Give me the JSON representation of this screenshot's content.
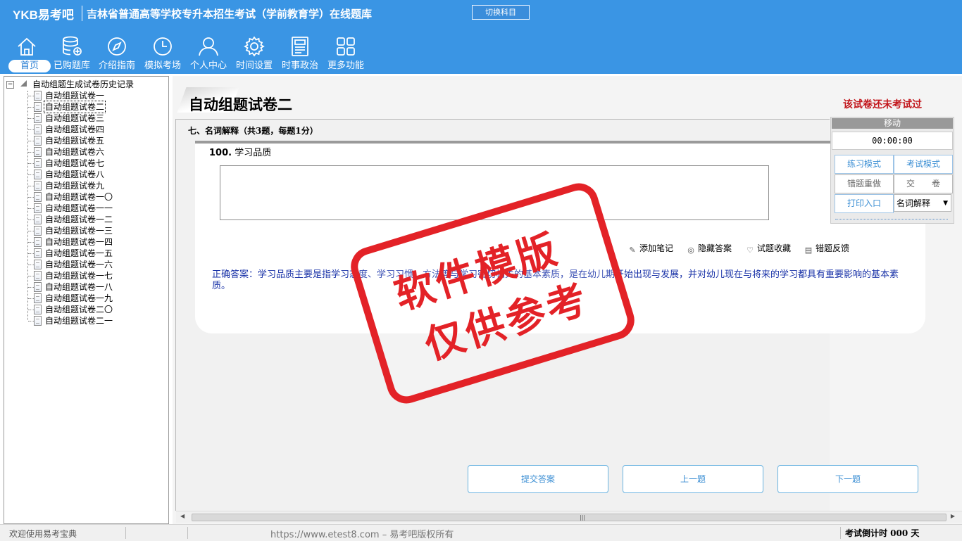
{
  "header": {
    "brand": "YKB易考吧",
    "title": "吉林省普通高等学校专升本招生考试（学前教育学）在线题库",
    "switch_label": "切换科目"
  },
  "nav": [
    {
      "label": "首页",
      "icon": "home-icon"
    },
    {
      "label": "已购题库",
      "icon": "database-icon"
    },
    {
      "label": "介绍指南",
      "icon": "compass-icon"
    },
    {
      "label": "模拟考场",
      "icon": "clock-icon"
    },
    {
      "label": "个人中心",
      "icon": "user-icon"
    },
    {
      "label": "时间设置",
      "icon": "gear-icon"
    },
    {
      "label": "时事政治",
      "icon": "newspaper-icon"
    },
    {
      "label": "更多功能",
      "icon": "grid-icon"
    }
  ],
  "tree": {
    "root": "自动组题生成试卷历史记录",
    "items": [
      "自动组题试卷一",
      "自动组题试卷二",
      "自动组题试卷三",
      "自动组题试卷四",
      "自动组题试卷五",
      "自动组题试卷六",
      "自动组题试卷七",
      "自动组题试卷八",
      "自动组题试卷九",
      "自动组题试卷一〇",
      "自动组题试卷一一",
      "自动组题试卷一二",
      "自动组题试卷一三",
      "自动组题试卷一四",
      "自动组题试卷一五",
      "自动组题试卷一六",
      "自动组题试卷一七",
      "自动组题试卷一八",
      "自动组题试卷一九",
      "自动组题试卷二〇",
      "自动组题试卷二一"
    ],
    "selected_index": 1
  },
  "main": {
    "paper_title": "自动组题试卷二",
    "status_note": "该试卷还未考试过",
    "section_title": "七、名词解释（共3题，每题1分）",
    "question_number": "100.",
    "question_text": "学习品质",
    "tools": {
      "note": "添加笔记",
      "hide": "隐藏答案",
      "favorite": "试题收藏",
      "feedback": "错题反馈"
    },
    "correct_answer": "正确答案：学习品质主要是指学习态度、学习习惯、方法等与学习密切相关的基本素质，是在幼儿期开始出现与发展，并对幼儿现在与将来的学习都具有重要影响的基本素质。",
    "stamp_line1": "软件模版",
    "stamp_line2": "仅供参考",
    "buttons": {
      "submit": "提交答案",
      "prev": "上一题",
      "next": "下一题"
    }
  },
  "side_panel": {
    "move": "移动",
    "timer": "00:00:00",
    "practice": "练习模式",
    "exam": "考试模式",
    "redo": "错题重做",
    "hand_in": "交　　卷",
    "print": "打印入口",
    "type_select": "名词解释"
  },
  "statusbar": {
    "welcome": "欢迎使用易考宝典",
    "copyright": "https://www.etest8.com – 易考吧版权所有",
    "countdown": "考试倒计时 000 天"
  }
}
